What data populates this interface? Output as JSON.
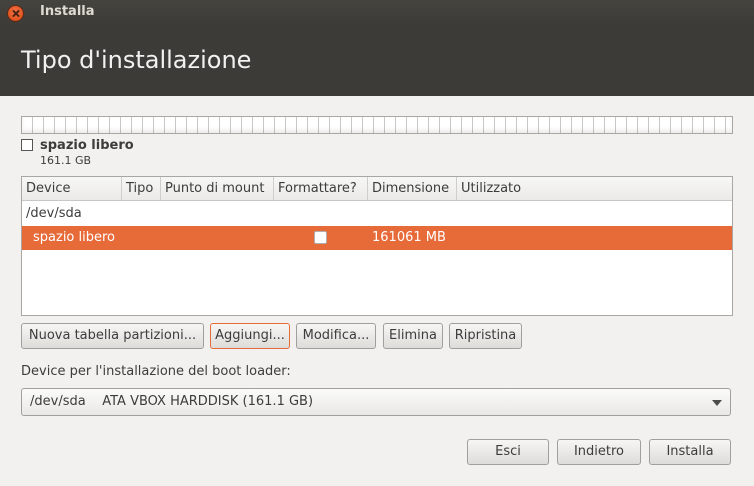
{
  "window": {
    "title": "Installa"
  },
  "page": {
    "title": "Tipo d'installazione"
  },
  "legend": {
    "name": "spazio libero",
    "size": "161.1 GB"
  },
  "table": {
    "columns": [
      "Device",
      "Tipo",
      "Punto di mount",
      "Formattare?",
      "Dimensione",
      "Utilizzato"
    ],
    "disk_row": {
      "device": "/dev/sda"
    },
    "selected_row": {
      "device": "spazio libero",
      "tipo": "",
      "mount": "",
      "format_checked": false,
      "size": "161061 MB",
      "used": ""
    }
  },
  "actions": {
    "new_table": "Nuova tabella partizioni...",
    "add": "Aggiungi...",
    "modify": "Modifica...",
    "delete": "Elimina",
    "revert": "Ripristina"
  },
  "bootloader": {
    "label": "Device per l'installazione del boot loader:",
    "selected": "/dev/sda    ATA VBOX HARDDISK (161.1 GB)"
  },
  "footer": {
    "quit": "Esci",
    "back": "Indietro",
    "install": "Installa"
  },
  "colors": {
    "accent": "#e76a39",
    "header_bg": "#3c3b37",
    "window_bg": "#f2f1f0"
  }
}
